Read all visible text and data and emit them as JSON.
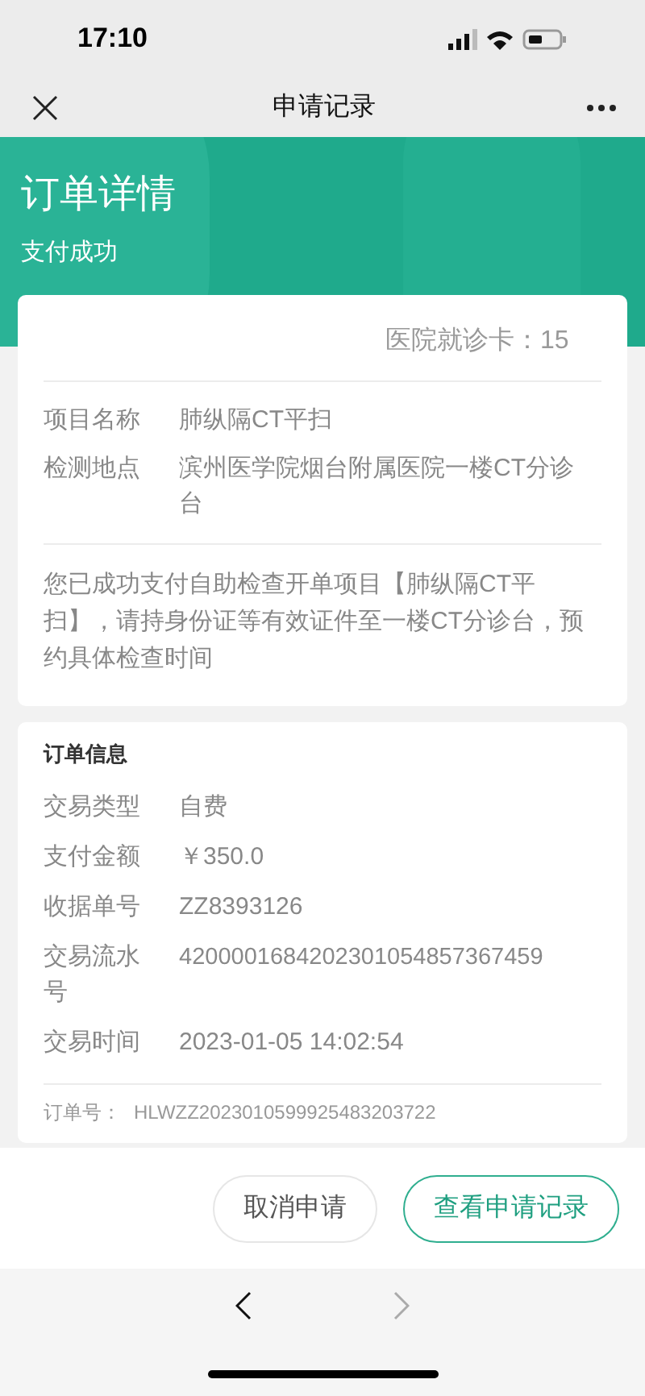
{
  "status_bar": {
    "time": "17:10"
  },
  "nav_bar": {
    "title": "申请记录"
  },
  "header": {
    "title": "订单详情",
    "subtitle": "支付成功"
  },
  "card": {
    "hospital_card_label": "医院就诊卡：",
    "hospital_card_value": "15",
    "fields": [
      {
        "label": "项目名称",
        "value": "肺纵隔CT平扫"
      },
      {
        "label": "检测地点",
        "value": "滨州医学院烟台附属医院一楼CT分诊台"
      }
    ],
    "notice": "您已成功支付自助检查开单项目【肺纵隔CT平扫】，请持身份证等有效证件至一楼CT分诊台，预约具体检查时间"
  },
  "order_info": {
    "title": "订单信息",
    "fields": [
      {
        "label": "交易类型",
        "value": "自费"
      },
      {
        "label": "支付金额",
        "value": "￥350.0"
      },
      {
        "label": "收据单号",
        "value": "ZZ8393126"
      },
      {
        "label": "交易流水号",
        "value": "4200001684202301054857367459"
      },
      {
        "label": "交易时间",
        "value": "2023-01-05 14:02:54"
      }
    ],
    "order_no_label": "订单号：",
    "order_no": "HLWZZ2023010599925483203722"
  },
  "actions": [
    {
      "label": "取消申请",
      "kind": "secondary"
    },
    {
      "label": "查看申请记录",
      "kind": "primary"
    }
  ],
  "browser_nav": [
    {
      "kind": "back",
      "disabled": false
    },
    {
      "kind": "forward",
      "disabled": true
    }
  ]
}
